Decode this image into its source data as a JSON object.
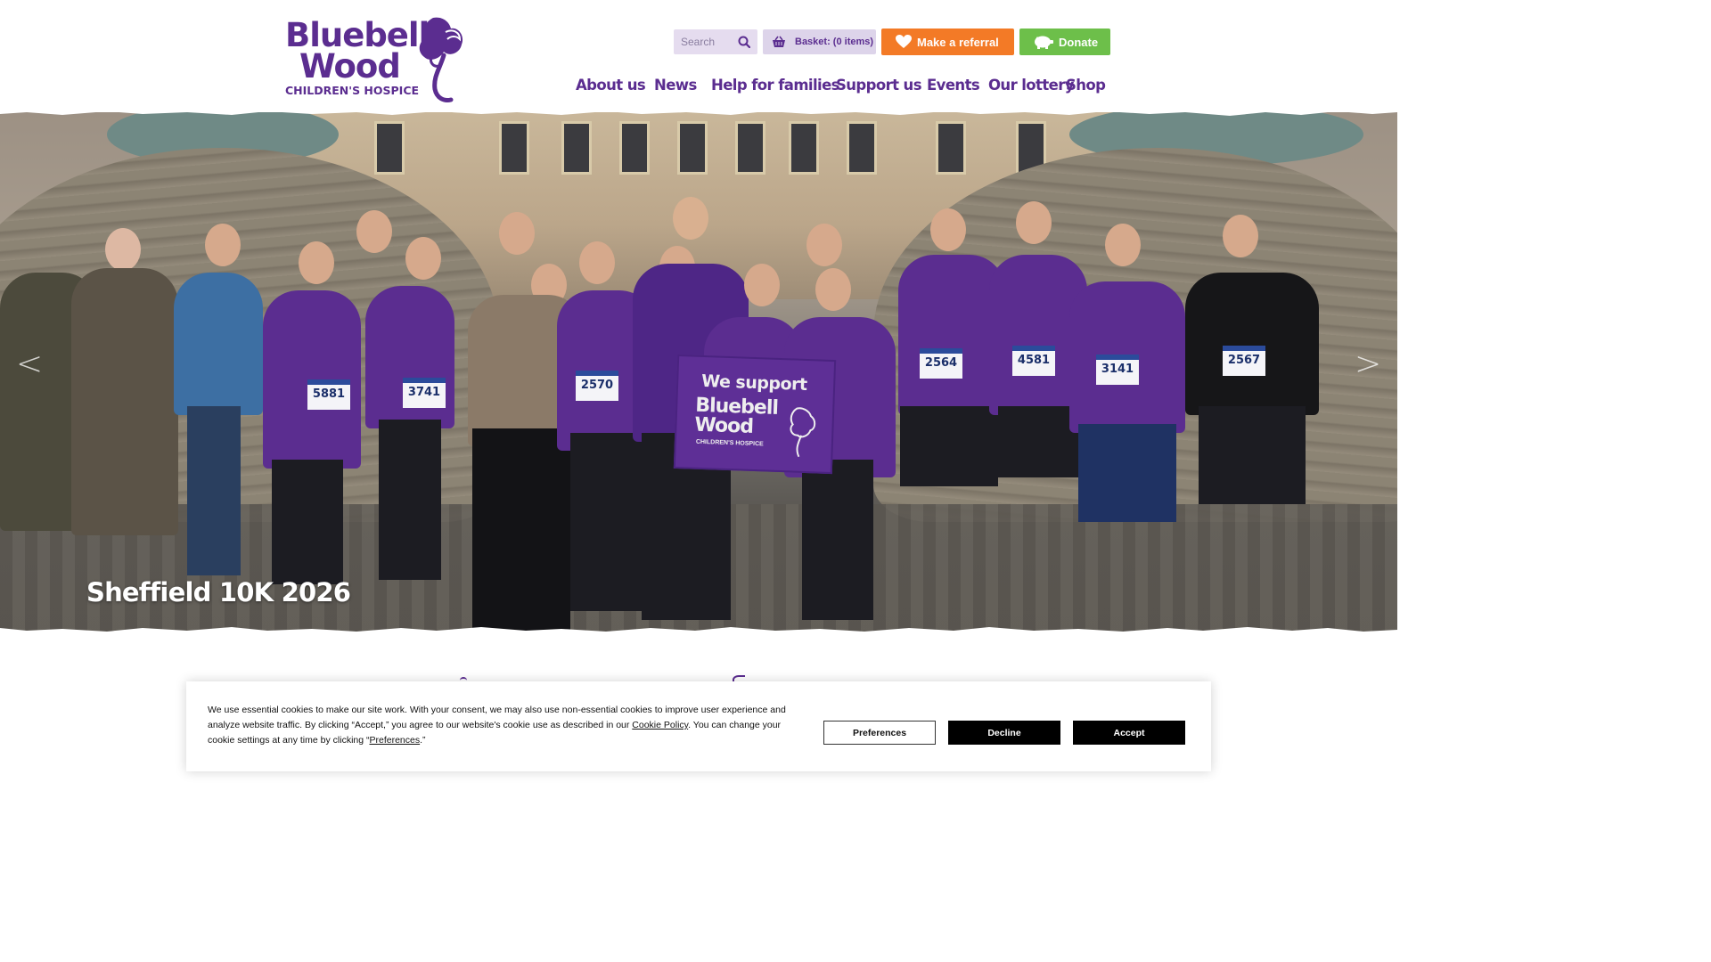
{
  "brand": {
    "name_line1": "Bluebell",
    "name_line2": "Wood",
    "tagline": "CHILDREN'S HOSPICE",
    "color": "#5b2d90"
  },
  "header": {
    "search_placeholder": "Search",
    "basket_label": "Basket: (0 items)",
    "referral_label": "Make a referral",
    "donate_label": "Donate",
    "referral_color": "#f37a26",
    "donate_color": "#6dbf4a"
  },
  "nav": {
    "items": [
      {
        "label": "About us"
      },
      {
        "label": "News"
      },
      {
        "label": "Help for families"
      },
      {
        "label": "Support us"
      },
      {
        "label": "Events"
      },
      {
        "label": "Our lottery"
      },
      {
        "label": "Shop"
      }
    ]
  },
  "hero": {
    "caption": "Sheffield 10K 2026",
    "prev_label": "<",
    "next_label": ">",
    "sign": {
      "line1": "We support",
      "line2": "Bluebell",
      "line3": "Wood",
      "line4": "CHILDREN'S HOSPICE"
    },
    "bibs": [
      "5881",
      "3741",
      "2570",
      "2564",
      "4581",
      "3141",
      "2567"
    ]
  },
  "cookie": {
    "text_part1": "We use essential cookies to make our site work. With your consent, we may also use non-essential cookies to improve user experience and analyze website traffic. By clicking “Accept,” you agree to our website's cookie use as described in our ",
    "policy_link": "Cookie Policy",
    "text_part2": ". You can change your cookie settings at any time by clicking “",
    "preferences_link": "Preferences",
    "text_part3": ".”",
    "preferences_button": "Preferences",
    "decline_button": "Decline",
    "accept_button": "Accept"
  }
}
